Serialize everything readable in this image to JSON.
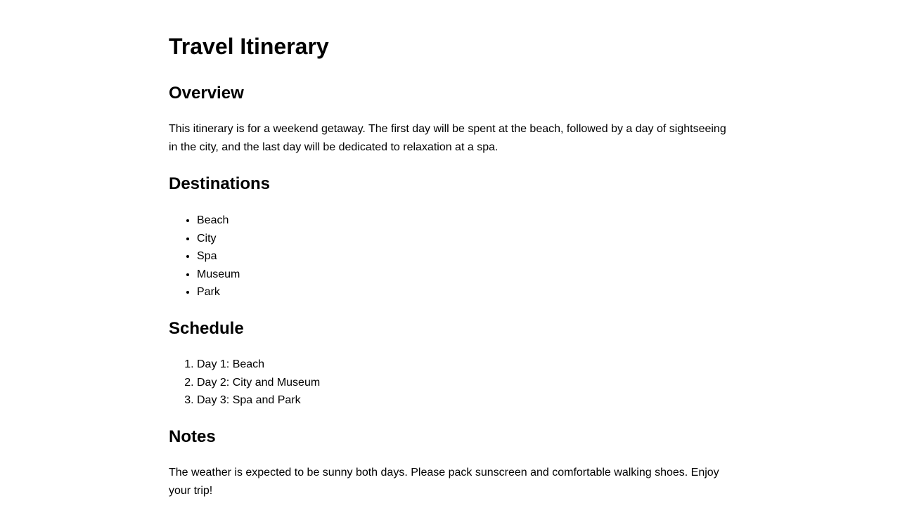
{
  "document": {
    "title": "Travel Itinerary",
    "sections": {
      "overview": {
        "heading": "Overview",
        "text": "This itinerary is for a weekend getaway. The first day will be spent at the beach, followed by a day of sightseeing in the city, and the last day will be dedicated to relaxation at a spa."
      },
      "destinations": {
        "heading": "Destinations",
        "items": [
          "Beach",
          "City",
          "Spa",
          "Museum",
          "Park"
        ]
      },
      "schedule": {
        "heading": "Schedule",
        "items": [
          "Day 1: Beach",
          "Day 2: City and Museum",
          "Day 3: Spa and Park"
        ]
      },
      "notes": {
        "heading": "Notes",
        "text": "The weather is expected to be sunny both days. Please pack sunscreen and comfortable walking shoes. Enjoy your trip!"
      }
    }
  }
}
